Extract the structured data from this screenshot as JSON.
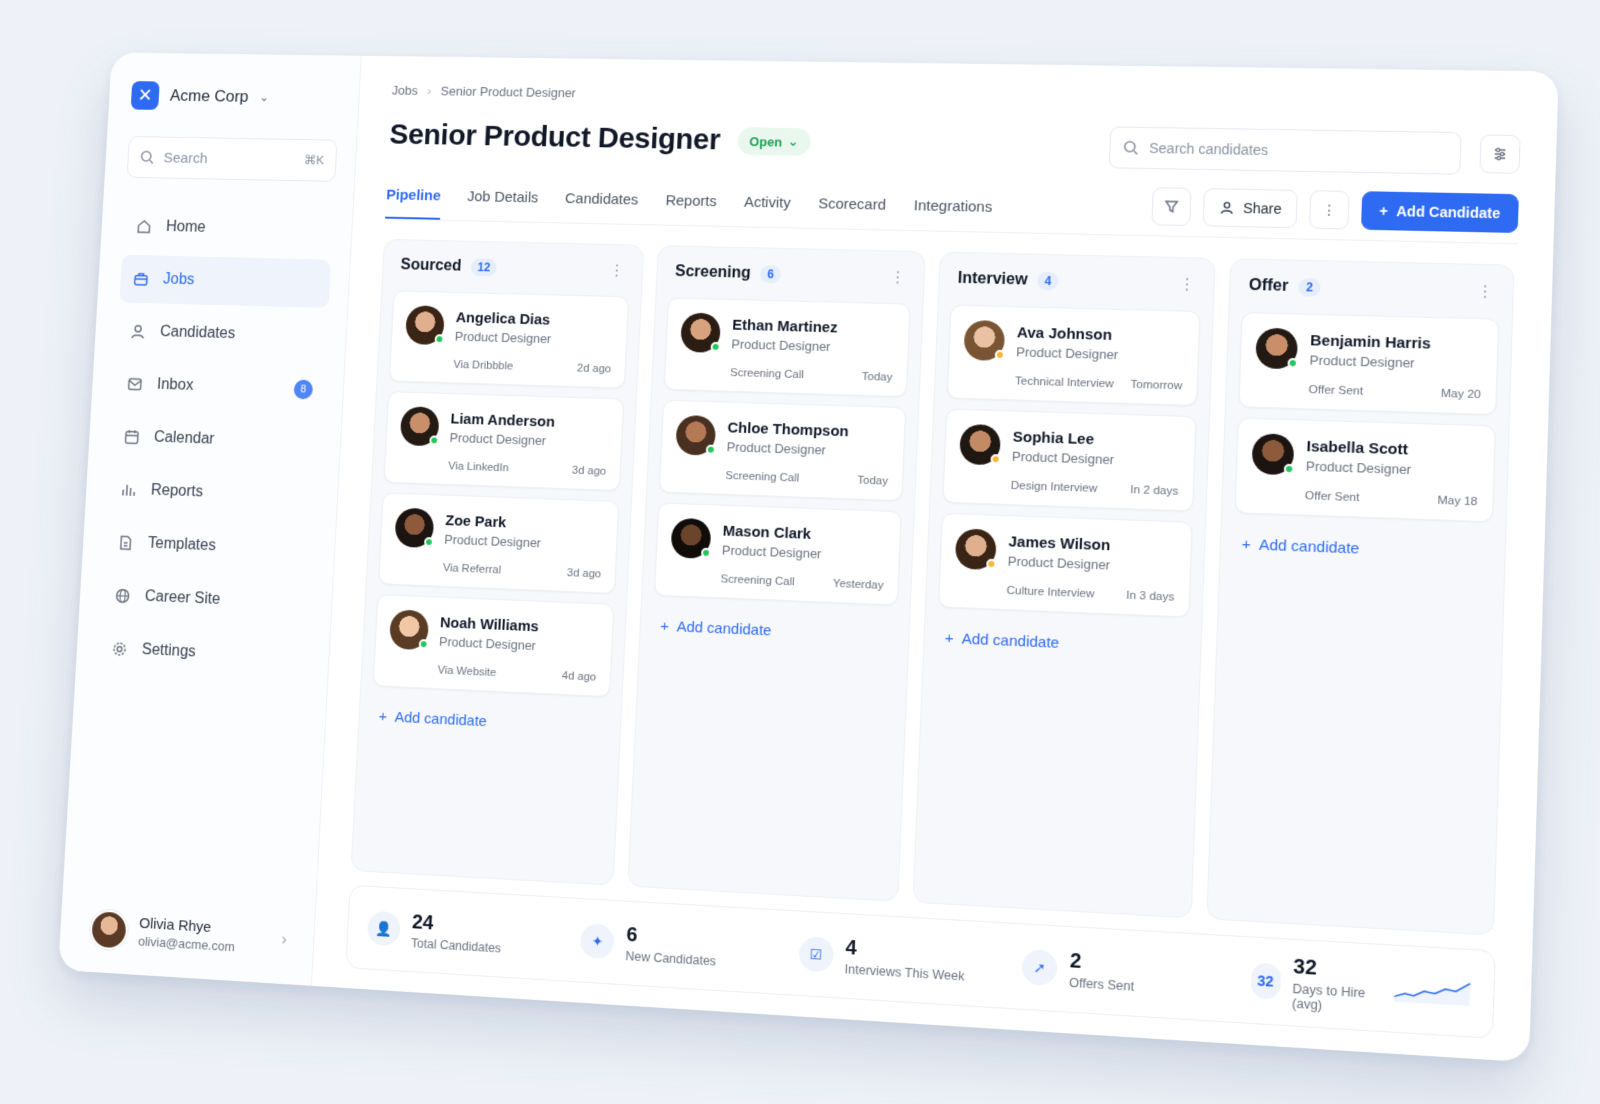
{
  "org": {
    "name": "Acme Corp"
  },
  "search": {
    "placeholder": "Search",
    "shortcut": "⌘K"
  },
  "nav": [
    {
      "label": "Home",
      "icon": "home-icon"
    },
    {
      "label": "Jobs",
      "icon": "briefcase-icon",
      "active": true
    },
    {
      "label": "Candidates",
      "icon": "user-icon"
    },
    {
      "label": "Inbox",
      "icon": "inbox-icon",
      "badge": "8"
    },
    {
      "label": "Calendar",
      "icon": "calendar-icon"
    },
    {
      "label": "Reports",
      "icon": "bar-chart-icon"
    },
    {
      "label": "Templates",
      "icon": "document-icon"
    },
    {
      "label": "Career Site",
      "icon": "globe-icon"
    },
    {
      "label": "Settings",
      "icon": "gear-icon"
    }
  ],
  "user": {
    "name": "Olivia Rhye",
    "email": "olivia@acme.com"
  },
  "breadcrumb": {
    "parent": "Jobs",
    "current": "Senior Product Designer"
  },
  "job": {
    "title": "Senior Product Designer",
    "status": "Open"
  },
  "top_search": {
    "placeholder": "Search candidates"
  },
  "tabs": [
    "Pipeline",
    "Job Details",
    "Candidates",
    "Reports",
    "Activity",
    "Scorecard",
    "Integrations"
  ],
  "actions": {
    "share": "Share",
    "add_candidate": "Add Candidate"
  },
  "columns": [
    {
      "title": "Sourced",
      "count": "12",
      "add_label": "Add candidate",
      "cards": [
        {
          "name": "Angelica Dias",
          "role": "Product Designer",
          "meta": "Via Dribbble",
          "time": "2d ago",
          "status": "green"
        },
        {
          "name": "Liam Anderson",
          "role": "Product Designer",
          "meta": "Via LinkedIn",
          "time": "3d ago",
          "status": "green"
        },
        {
          "name": "Zoe Park",
          "role": "Product Designer",
          "meta": "Via Referral",
          "time": "3d ago",
          "status": "green"
        },
        {
          "name": "Noah Williams",
          "role": "Product Designer",
          "meta": "Via Website",
          "time": "4d ago",
          "status": "green"
        }
      ]
    },
    {
      "title": "Screening",
      "count": "6",
      "add_label": "Add candidate",
      "cards": [
        {
          "name": "Ethan Martinez",
          "role": "Product Designer",
          "meta": "Screening Call",
          "time": "Today",
          "status": "green"
        },
        {
          "name": "Chloe Thompson",
          "role": "Product Designer",
          "meta": "Screening Call",
          "time": "Today",
          "status": "green"
        },
        {
          "name": "Mason Clark",
          "role": "Product Designer",
          "meta": "Screening Call",
          "time": "Yesterday",
          "status": "green"
        }
      ]
    },
    {
      "title": "Interview",
      "count": "4",
      "add_label": "Add candidate",
      "cards": [
        {
          "name": "Ava Johnson",
          "role": "Product Designer",
          "meta": "Technical Interview",
          "time": "Tomorrow",
          "status": "yellow"
        },
        {
          "name": "Sophia Lee",
          "role": "Product Designer",
          "meta": "Design Interview",
          "time": "In 2 days",
          "status": "yellow"
        },
        {
          "name": "James Wilson",
          "role": "Product Designer",
          "meta": "Culture Interview",
          "time": "In 3 days",
          "status": "yellow"
        }
      ]
    },
    {
      "title": "Offer",
      "count": "2",
      "add_label": "Add candidate",
      "cards": [
        {
          "name": "Benjamin Harris",
          "role": "Product Designer",
          "meta": "Offer Sent",
          "time": "May 20",
          "status": "green"
        },
        {
          "name": "Isabella Scott",
          "role": "Product Designer",
          "meta": "Offer Sent",
          "time": "May 18",
          "status": "green"
        }
      ]
    }
  ],
  "stats": [
    {
      "value": "24",
      "label": "Total Candidates",
      "icon": "user-icon"
    },
    {
      "value": "6",
      "label": "New Candidates",
      "icon": "sparkle-icon"
    },
    {
      "value": "4",
      "label": "Interviews This Week",
      "icon": "calendar-check-icon"
    },
    {
      "value": "2",
      "label": "Offers Sent",
      "icon": "send-icon"
    },
    {
      "value": "32",
      "label": "Days to Hire (avg)",
      "icon": "32"
    }
  ],
  "colors": {
    "accent": "#2f6bf2",
    "status_green": "#22c55e",
    "status_yellow": "#f5b83d"
  }
}
